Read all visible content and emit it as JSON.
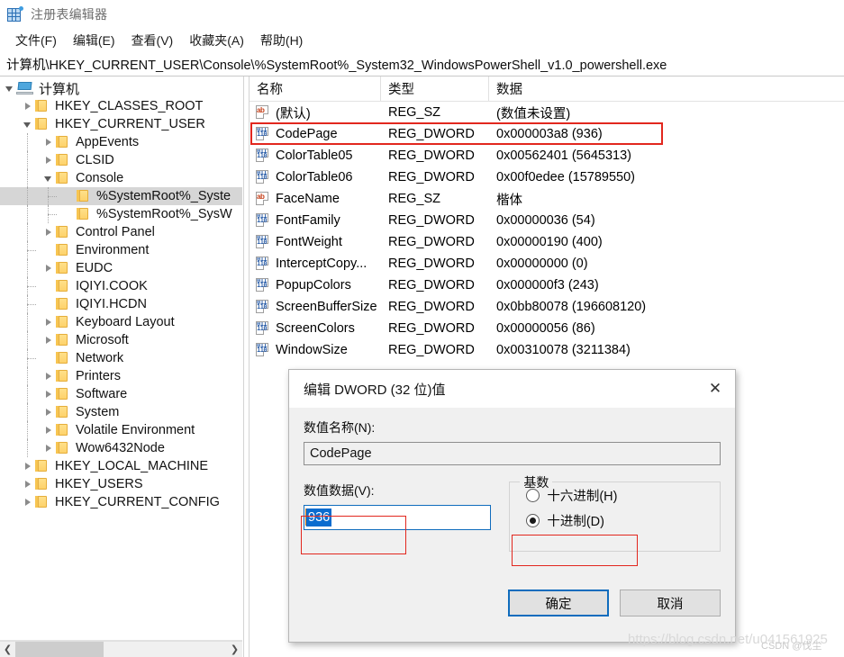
{
  "window": {
    "title": "注册表编辑器",
    "icon": "registry-editor-icon"
  },
  "menubar": {
    "items": [
      {
        "label": "文件(F)",
        "name": "menu-file"
      },
      {
        "label": "编辑(E)",
        "name": "menu-edit"
      },
      {
        "label": "查看(V)",
        "name": "menu-view"
      },
      {
        "label": "收藏夹(A)",
        "name": "menu-favorites"
      },
      {
        "label": "帮助(H)",
        "name": "menu-help"
      }
    ]
  },
  "addressbar": {
    "path": "计算机\\HKEY_CURRENT_USER\\Console\\%SystemRoot%_System32_WindowsPowerShell_v1.0_powershell.exe"
  },
  "tree": {
    "nodes": [
      {
        "label": "计算机",
        "level": 0,
        "state": "expanded",
        "icon": "computer-icon",
        "selected": false
      },
      {
        "label": "HKEY_CLASSES_ROOT",
        "level": 1,
        "state": "collapsed",
        "icon": "folder-icon",
        "selected": false
      },
      {
        "label": "HKEY_CURRENT_USER",
        "level": 1,
        "state": "expanded",
        "icon": "folder-icon",
        "selected": false
      },
      {
        "label": "AppEvents",
        "level": 2,
        "state": "collapsed",
        "icon": "folder-icon",
        "selected": false
      },
      {
        "label": "CLSID",
        "level": 2,
        "state": "collapsed",
        "icon": "folder-icon",
        "selected": false
      },
      {
        "label": "Console",
        "level": 2,
        "state": "expanded",
        "icon": "folder-icon",
        "selected": false
      },
      {
        "label": "%SystemRoot%_Syste",
        "level": 3,
        "state": "leaf",
        "icon": "folder-icon",
        "selected": true
      },
      {
        "label": "%SystemRoot%_SysW",
        "level": 3,
        "state": "leaf",
        "icon": "folder-icon",
        "selected": false
      },
      {
        "label": "Control Panel",
        "level": 2,
        "state": "collapsed",
        "icon": "folder-icon",
        "selected": false
      },
      {
        "label": "Environment",
        "level": 2,
        "state": "leaf",
        "icon": "folder-icon",
        "selected": false
      },
      {
        "label": "EUDC",
        "level": 2,
        "state": "collapsed",
        "icon": "folder-icon",
        "selected": false
      },
      {
        "label": "IQIYI.COOK",
        "level": 2,
        "state": "leaf",
        "icon": "folder-icon",
        "selected": false
      },
      {
        "label": "IQIYI.HCDN",
        "level": 2,
        "state": "leaf",
        "icon": "folder-icon",
        "selected": false
      },
      {
        "label": "Keyboard Layout",
        "level": 2,
        "state": "collapsed",
        "icon": "folder-icon",
        "selected": false
      },
      {
        "label": "Microsoft",
        "level": 2,
        "state": "collapsed",
        "icon": "folder-icon",
        "selected": false
      },
      {
        "label": "Network",
        "level": 2,
        "state": "leaf",
        "icon": "folder-icon",
        "selected": false
      },
      {
        "label": "Printers",
        "level": 2,
        "state": "collapsed",
        "icon": "folder-icon",
        "selected": false
      },
      {
        "label": "Software",
        "level": 2,
        "state": "collapsed",
        "icon": "folder-icon",
        "selected": false
      },
      {
        "label": "System",
        "level": 2,
        "state": "collapsed",
        "icon": "folder-icon",
        "selected": false
      },
      {
        "label": "Volatile Environment",
        "level": 2,
        "state": "collapsed",
        "icon": "folder-icon",
        "selected": false
      },
      {
        "label": "Wow6432Node",
        "level": 2,
        "state": "collapsed",
        "icon": "folder-icon",
        "selected": false
      },
      {
        "label": "HKEY_LOCAL_MACHINE",
        "level": 1,
        "state": "collapsed",
        "icon": "folder-icon",
        "selected": false
      },
      {
        "label": "HKEY_USERS",
        "level": 1,
        "state": "collapsed",
        "icon": "folder-icon",
        "selected": false
      },
      {
        "label": "HKEY_CURRENT_CONFIG",
        "level": 1,
        "state": "collapsed",
        "icon": "folder-icon",
        "selected": false
      }
    ]
  },
  "list": {
    "columns": [
      "名称",
      "类型",
      "数据"
    ],
    "rows": [
      {
        "name": "(默认)",
        "type": "REG_SZ",
        "data": "(数值未设置)",
        "icon": "string-value-icon",
        "highlighted": false
      },
      {
        "name": "CodePage",
        "type": "REG_DWORD",
        "data": "0x000003a8 (936)",
        "icon": "dword-value-icon",
        "highlighted": true
      },
      {
        "name": "ColorTable05",
        "type": "REG_DWORD",
        "data": "0x00562401 (5645313)",
        "icon": "dword-value-icon",
        "highlighted": false
      },
      {
        "name": "ColorTable06",
        "type": "REG_DWORD",
        "data": "0x00f0edee (15789550)",
        "icon": "dword-value-icon",
        "highlighted": false
      },
      {
        "name": "FaceName",
        "type": "REG_SZ",
        "data": "楷体",
        "icon": "string-value-icon",
        "highlighted": false
      },
      {
        "name": "FontFamily",
        "type": "REG_DWORD",
        "data": "0x00000036 (54)",
        "icon": "dword-value-icon",
        "highlighted": false
      },
      {
        "name": "FontWeight",
        "type": "REG_DWORD",
        "data": "0x00000190 (400)",
        "icon": "dword-value-icon",
        "highlighted": false
      },
      {
        "name": "InterceptCopy...",
        "type": "REG_DWORD",
        "data": "0x00000000 (0)",
        "icon": "dword-value-icon",
        "highlighted": false
      },
      {
        "name": "PopupColors",
        "type": "REG_DWORD",
        "data": "0x000000f3 (243)",
        "icon": "dword-value-icon",
        "highlighted": false
      },
      {
        "name": "ScreenBufferSize",
        "type": "REG_DWORD",
        "data": "0x0bb80078 (196608120)",
        "icon": "dword-value-icon",
        "highlighted": false
      },
      {
        "name": "ScreenColors",
        "type": "REG_DWORD",
        "data": "0x00000056 (86)",
        "icon": "dword-value-icon",
        "highlighted": false
      },
      {
        "name": "WindowSize",
        "type": "REG_DWORD",
        "data": "0x00310078 (3211384)",
        "icon": "dword-value-icon",
        "highlighted": false
      }
    ]
  },
  "dialog": {
    "title": "编辑 DWORD (32 位)值",
    "close_label": "✕",
    "value_name_label": "数值名称(N):",
    "value_name": "CodePage",
    "value_data_label": "数值数据(V):",
    "value_data": "936",
    "base_legend": "基数",
    "radios": [
      {
        "label": "十六进制(H)",
        "checked": false,
        "name": "radio-hexadecimal"
      },
      {
        "label": "十进制(D)",
        "checked": true,
        "name": "radio-decimal"
      }
    ],
    "ok_label": "确定",
    "cancel_label": "取消"
  },
  "watermark": {
    "url": "https://blog.csdn.net/u041561925",
    "author": "CSDN @伐尘"
  },
  "colors": {
    "highlight_red": "#e2271e",
    "accent_blue": "#0f6cbd",
    "selection_blue": "#0a6ccf",
    "folder_yellow": "#fdd26b"
  }
}
